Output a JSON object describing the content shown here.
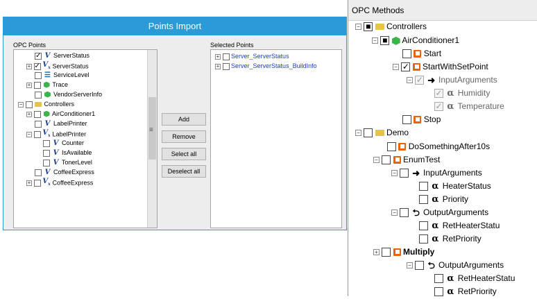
{
  "points_import": {
    "title": "Points Import",
    "opc_points_label": "OPC Points",
    "selected_points_label": "Selected Points",
    "opc_tree": [
      {
        "label": "ServerStatus",
        "checked": "✓",
        "icon": "V"
      },
      {
        "label": "ServerStatus",
        "checked": "✓",
        "icon": "Vx",
        "expand": "+"
      },
      {
        "label": "ServiceLevel",
        "checked": "",
        "icon": "list"
      },
      {
        "label": "Trace",
        "checked": "",
        "icon": "cube",
        "expand": "+"
      },
      {
        "label": "VendorServerInfo",
        "checked": "",
        "icon": "cube"
      },
      {
        "label": "Controllers",
        "checked": "",
        "icon": "folder",
        "expand": "−"
      },
      {
        "label": "AirConditioner1",
        "checked": "",
        "icon": "cube",
        "expand": "+"
      },
      {
        "label": "LabelPrinter",
        "checked": "",
        "icon": "V"
      },
      {
        "label": "LabelPrinter",
        "checked": "",
        "icon": "Vx",
        "expand": "−"
      },
      {
        "label": "Counter",
        "checked": "",
        "icon": "V"
      },
      {
        "label": "IsAvailable",
        "checked": "",
        "icon": "V"
      },
      {
        "label": "TonerLevel",
        "checked": "",
        "icon": "V"
      },
      {
        "label": "CoffeeExpress",
        "checked": "",
        "icon": "V"
      },
      {
        "label": "CoffeeExpress",
        "checked": "",
        "icon": "Vx",
        "expand": "+"
      }
    ],
    "selected_tree": [
      {
        "label": "Server_ServerStatus"
      },
      {
        "label": "Server_ServerStatus_BuildInfo"
      }
    ],
    "buttons": {
      "add": "Add",
      "remove": "Remove",
      "select_all": "Select all",
      "deselect_all": "Deselect all"
    },
    "splitter_glyph": "≡",
    "accent_color": "#2b9bd8"
  },
  "opc_methods": {
    "title": "OPC Methods",
    "tree": [
      {
        "label": "Controllers",
        "check": "■"
      },
      {
        "label": "AirConditioner1",
        "check": "■"
      },
      {
        "label": "Start",
        "check": ""
      },
      {
        "label": "StartWithSetPoint",
        "check": "✓"
      },
      {
        "label": "InputArguments",
        "check": "✓"
      },
      {
        "label": "Humidity",
        "check": "✓"
      },
      {
        "label": "Temperature",
        "check": "✓"
      },
      {
        "label": "Stop",
        "check": ""
      },
      {
        "label": "Demo",
        "check": ""
      },
      {
        "label": "DoSomethingAfter10s",
        "check": ""
      },
      {
        "label": "EnumTest",
        "check": ""
      },
      {
        "label": "InputArguments",
        "check": ""
      },
      {
        "label": "HeaterStatus",
        "check": ""
      },
      {
        "label": "Priority",
        "check": ""
      },
      {
        "label": "OutputArguments",
        "check": ""
      },
      {
        "label": "RetHeaterStatu",
        "check": ""
      },
      {
        "label": "RetPriority",
        "check": ""
      },
      {
        "label": "Multiply",
        "check": ""
      },
      {
        "label": "OutputArguments",
        "check": ""
      },
      {
        "label": "RetHeaterStatu",
        "check": ""
      },
      {
        "label": "RetPriority",
        "check": ""
      }
    ],
    "icons": {
      "alpha": "α",
      "input_arg": "➜",
      "output_arg": "➜"
    }
  }
}
